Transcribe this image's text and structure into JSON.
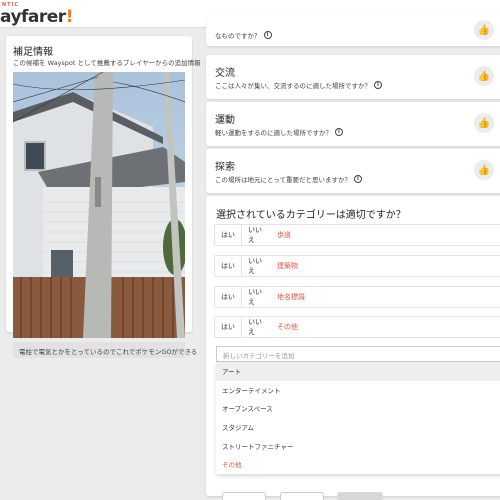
{
  "header": {
    "logo_sup": "NTIC",
    "logo_text": "ayfarer",
    "logo_mark": "!"
  },
  "supplement": {
    "title": "補足情報",
    "subtitle": "この候補を Wayspot として推薦するプレイヤーからの追加情報",
    "caption": "電柱で電気とかをとっているのでこれでポケモンGOができる"
  },
  "questions": [
    {
      "title": "",
      "text": "なものですか？",
      "thumb_icon": "thumbs-up-icon"
    },
    {
      "title": "交流",
      "text": "ここは人々が集い、交流するのに適した場所ですか？",
      "thumb_icon": "thumbs-up-icon"
    },
    {
      "title": "運動",
      "text": "軽い運動をするのに適した場所ですか？",
      "thumb_icon": "thumbs-up-icon"
    },
    {
      "title": "探索",
      "text": "この場所は地元にとって重要だと思いますか？",
      "thumb_icon": "thumbs-up-icon"
    }
  ],
  "categories": {
    "title": "選択されているカテゴリーは適切ですか？",
    "yes_label": "はい",
    "no_label": "いいえ",
    "rows": [
      {
        "name": "歩道"
      },
      {
        "name": "建築物"
      },
      {
        "name": "地名標識"
      },
      {
        "name": "その他"
      }
    ],
    "add_placeholder": "新しいカテゴリーを追加",
    "options": [
      {
        "label": "アート",
        "highlighted": true,
        "red": false
      },
      {
        "label": "エンターテイメント",
        "highlighted": false,
        "red": false
      },
      {
        "label": "オープンスペース",
        "highlighted": false,
        "red": false
      },
      {
        "label": "スタジアム",
        "highlighted": false,
        "red": false
      },
      {
        "label": "ストリートファニチャー",
        "highlighted": false,
        "red": false
      },
      {
        "label": "その他",
        "highlighted": false,
        "red": true
      }
    ]
  },
  "colors": {
    "accent": "#e0553d",
    "brand": "#f47b20"
  }
}
